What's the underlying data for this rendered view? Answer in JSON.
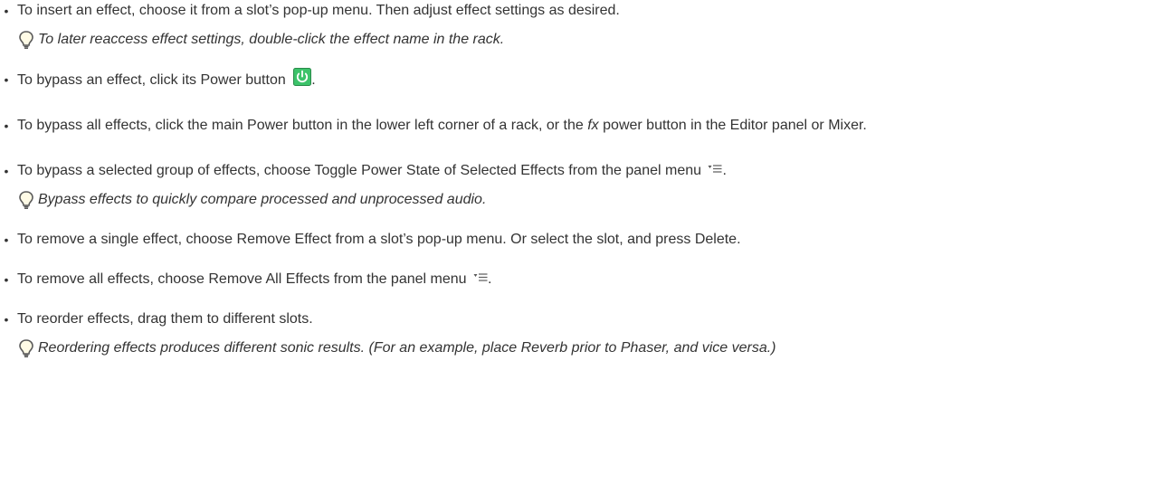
{
  "items": [
    {
      "text": "To insert an effect, choose it from a slot’s pop-up menu. Then adjust effect settings as desired.",
      "tip": "To later reaccess effect settings, double-click the effect name in the rack."
    },
    {
      "text_before": "To bypass an effect, click its Power button",
      "text_after": ".",
      "icon": "power-button-icon"
    },
    {
      "text_before": "To bypass all effects, click the main Power button in the lower left corner of a rack, or the",
      "text_em": "fx",
      "text_after": "power button in the Editor panel or Mixer."
    },
    {
      "text_before": "To bypass a selected group of effects, choose Toggle Power State of Selected Effects from the panel menu",
      "text_after": ".",
      "icon": "panel-menu-icon",
      "tip": "Bypass effects to quickly compare processed and unprocessed audio."
    },
    {
      "text": "To remove a single effect, choose Remove Effect from a slot’s pop-up menu. Or select the slot, and press Delete."
    },
    {
      "text_before": "To remove all effects, choose Remove All Effects from the panel menu",
      "text_after": ".",
      "icon": "panel-menu-icon"
    },
    {
      "text": "To reorder effects, drag them to different slots.",
      "tip": "Reordering effects produces different sonic results. (For an example, place Reverb prior to Phaser, and vice versa.)"
    }
  ],
  "colors": {
    "text": "#333333",
    "bulb_outline": "#5a5a5a",
    "power_button_bg": "#3cc36a",
    "power_button_border": "#2a8a4a"
  }
}
